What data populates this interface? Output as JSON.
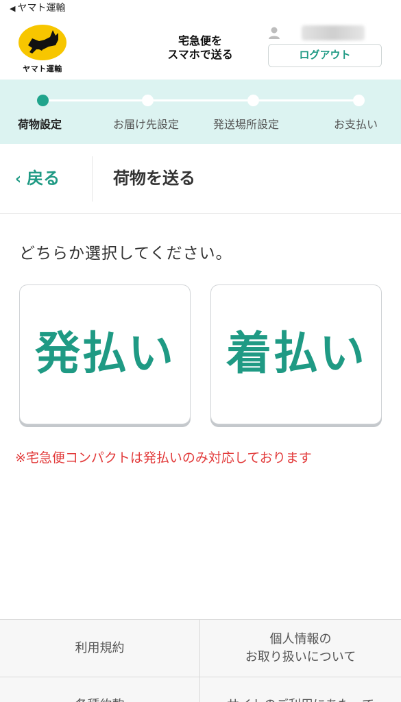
{
  "status_bar": {
    "back_app_label": "ヤマト運輸",
    "back_arrow": "◀"
  },
  "header": {
    "logo_text": "ヤマト運輸",
    "brand_title_line1": "宅急便を",
    "brand_title_line2": "スマホで送る",
    "logout_label": "ログアウト"
  },
  "steps": {
    "items": [
      {
        "label": "荷物設定",
        "active": true
      },
      {
        "label": "お届け先設定",
        "active": false
      },
      {
        "label": "発送場所設定",
        "active": false
      },
      {
        "label": "お支払い",
        "active": false
      }
    ]
  },
  "titlebar": {
    "back_label": "戻る",
    "back_chevron": "‹",
    "title": "荷物を送る"
  },
  "main": {
    "prompt": "どちらか選択してください。",
    "choices": [
      {
        "label": "発払い"
      },
      {
        "label": "着払い"
      }
    ],
    "notice": "※宅急便コンパクトは発払いのみ対応しております"
  },
  "footer": {
    "links": [
      {
        "line1": "利用規約",
        "line2": ""
      },
      {
        "line1": "個人情報の",
        "line2": "お取り扱いについて"
      },
      {
        "line1": "各種約款",
        "line2": ""
      },
      {
        "line1": "サイトのご利用にあたって",
        "line2": ""
      }
    ]
  },
  "colors": {
    "accent": "#1f9a84",
    "step_bg": "#dcf3f1",
    "notice": "#e23a3a",
    "logo_yellow": "#f7c600"
  }
}
